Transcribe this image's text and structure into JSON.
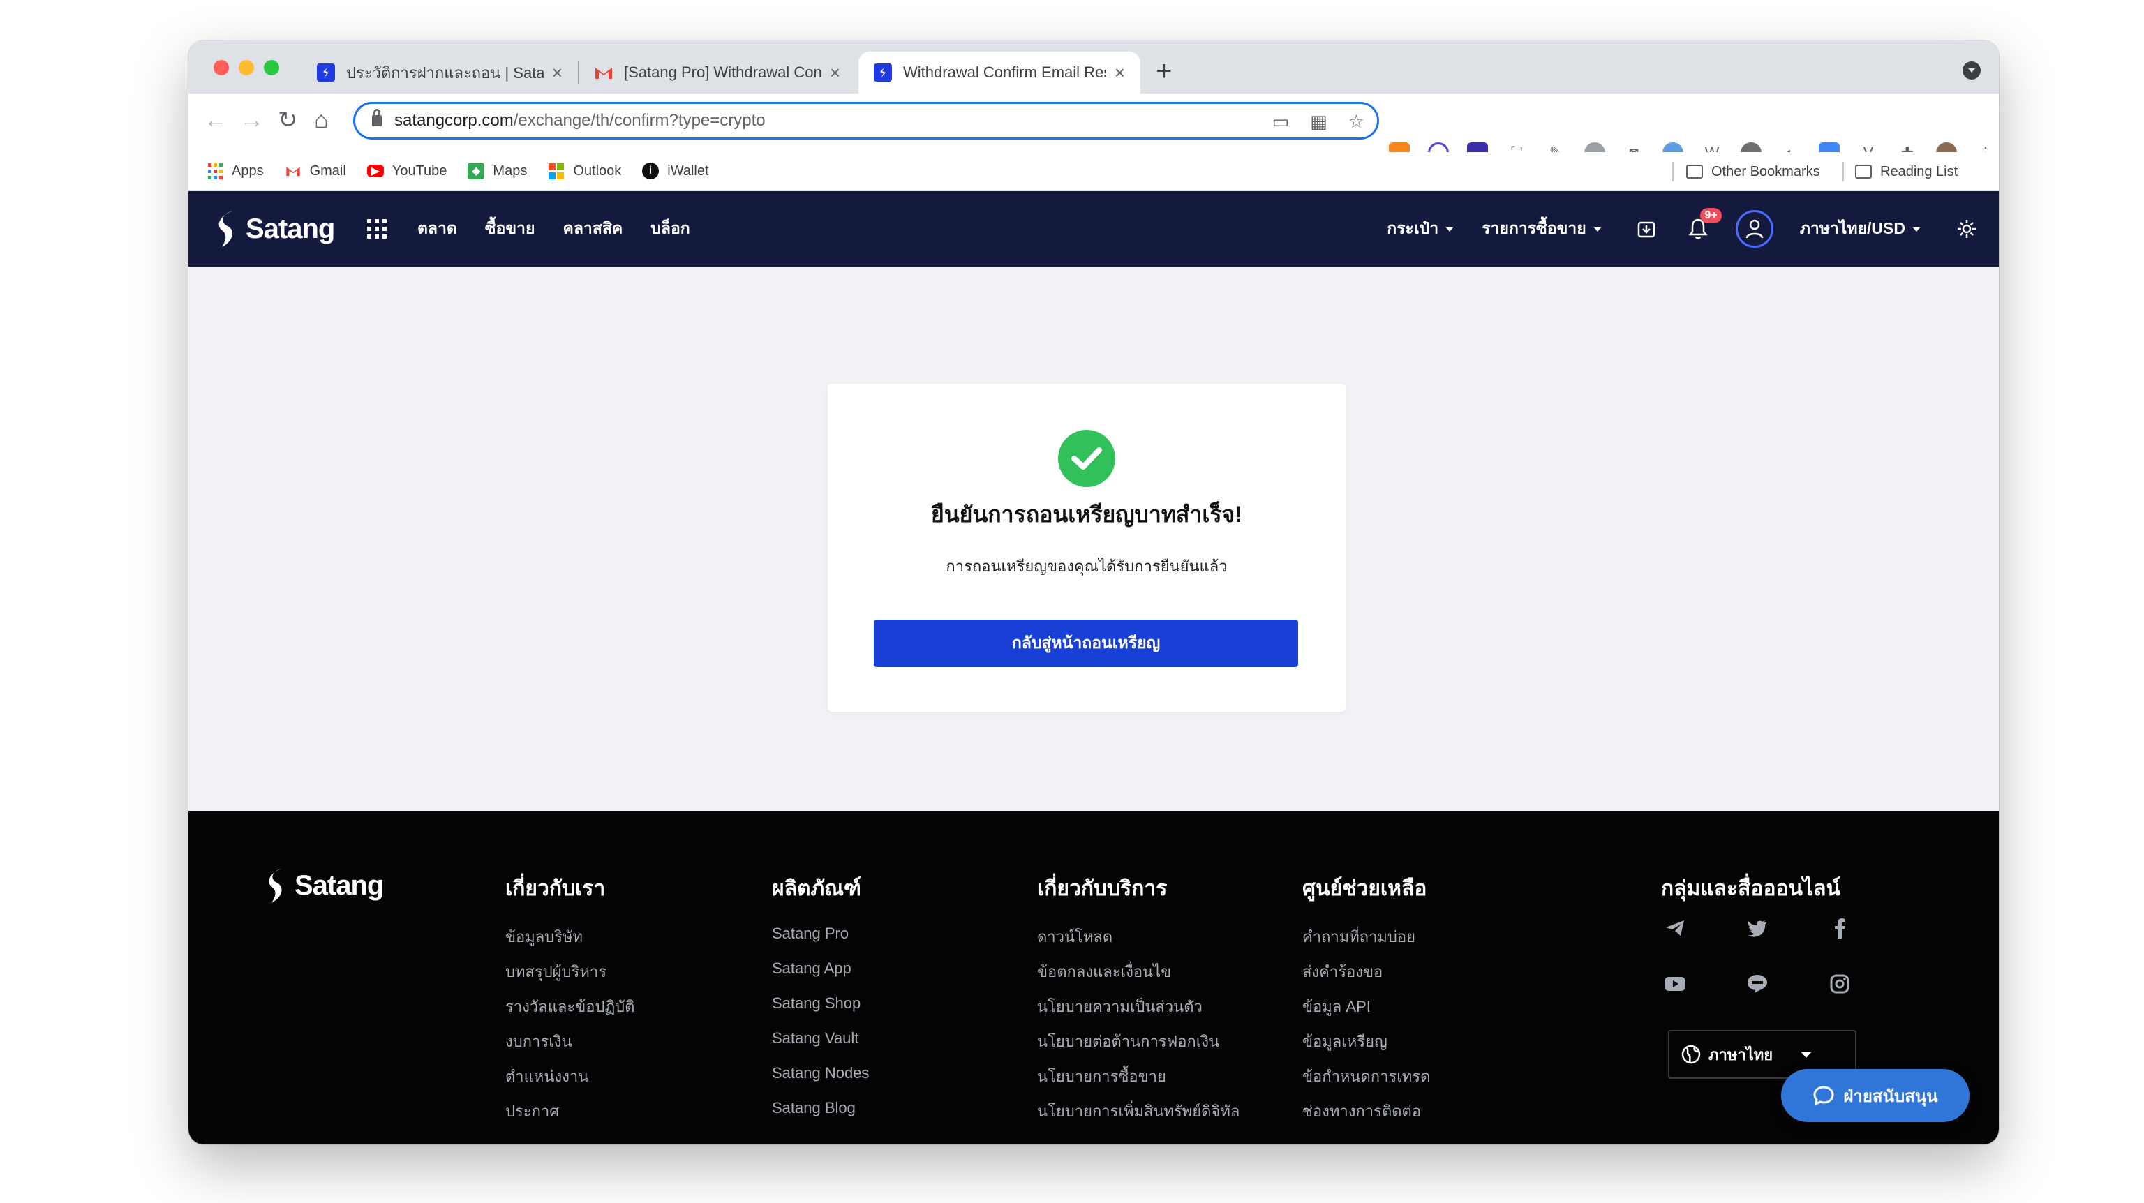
{
  "browser": {
    "tabs": [
      {
        "title": "ประวัติการฝากและถอน | Satangc",
        "favicon_color": "#1f3ae0"
      },
      {
        "title": "[Satang Pro] Withdrawal Confir",
        "favicon_color": "#ea4335"
      },
      {
        "title": "Withdrawal Confirm Email Resu",
        "favicon_color": "#1f3ae0"
      }
    ],
    "address": {
      "host": "satangcorp.com",
      "path": "/exchange/th/confirm?type=crypto"
    },
    "bookmarks": [
      {
        "label": "Apps",
        "color": "#ea4335"
      },
      {
        "label": "Gmail",
        "color": "#ea4335"
      },
      {
        "label": "YouTube",
        "color": "#ff0000"
      },
      {
        "label": "Maps",
        "color": "#34a853"
      },
      {
        "label": "Outlook",
        "color": "#f25022"
      },
      {
        "label": "iWallet",
        "color": "#111111"
      }
    ],
    "bookmarks_right": {
      "other": "Other Bookmarks",
      "reading": "Reading List"
    }
  },
  "site": {
    "brand": "Satang",
    "nav": [
      "ตลาด",
      "ซื้อขาย",
      "คลาสสิค",
      "บล็อก"
    ],
    "wallet": "กระเป๋า",
    "orders": "รายการซื้อขาย",
    "notif_badge": "9+",
    "locale": "ภาษาไทย/USD",
    "colors": {
      "header_bg": "#141a3d",
      "primary": "#1940d6",
      "success": "#32c05a"
    }
  },
  "confirm": {
    "title": "ยืนยันการถอนเหรียญบาทสำเร็จ!",
    "subtitle": "การถอนเหรียญของคุณได้รับการยืนยันแล้ว",
    "button": "กลับสู่หน้าถอนเหรียญ"
  },
  "footer": {
    "brand": "Satang",
    "columns": [
      {
        "heading": "เกี่ยวกับเรา",
        "links": [
          "ข้อมูลบริษัท",
          "บทสรุปผู้บริหาร",
          "รางวัลและข้อปฏิบัติ",
          "งบการเงิน",
          "ตำแหน่งงาน",
          "ประกาศ"
        ]
      },
      {
        "heading": "ผลิตภัณฑ์",
        "links": [
          "Satang Pro",
          "Satang App",
          "Satang Shop",
          "Satang Vault",
          "Satang Nodes",
          "Satang Blog"
        ]
      },
      {
        "heading": "เกี่ยวกับบริการ",
        "links": [
          "ดาวน์โหลด",
          "ข้อตกลงและเงื่อนไข",
          "นโยบายความเป็นส่วนตัว",
          "นโยบายต่อต้านการฟอกเงิน",
          "นโยบายการซื้อขาย",
          "นโยบายการเพิ่มสินทรัพย์ดิจิทัล"
        ]
      },
      {
        "heading": "ศูนย์ช่วยเหลือ",
        "links": [
          "คำถามที่ถามบ่อย",
          "ส่งคำร้องขอ",
          "ข้อมูล API",
          "ข้อมูลเหรียญ",
          "ข้อกำหนดการเทรด",
          "ช่องทางการติดต่อ"
        ]
      }
    ],
    "social_heading": "กลุ่มและสื่อออนไลน์",
    "social_icons": [
      "telegram-icon",
      "twitter-icon",
      "facebook-icon",
      "youtube-icon",
      "line-icon",
      "instagram-icon"
    ],
    "language": "ภาษาไทย",
    "support": "ฝ่ายสนับสนุน"
  }
}
